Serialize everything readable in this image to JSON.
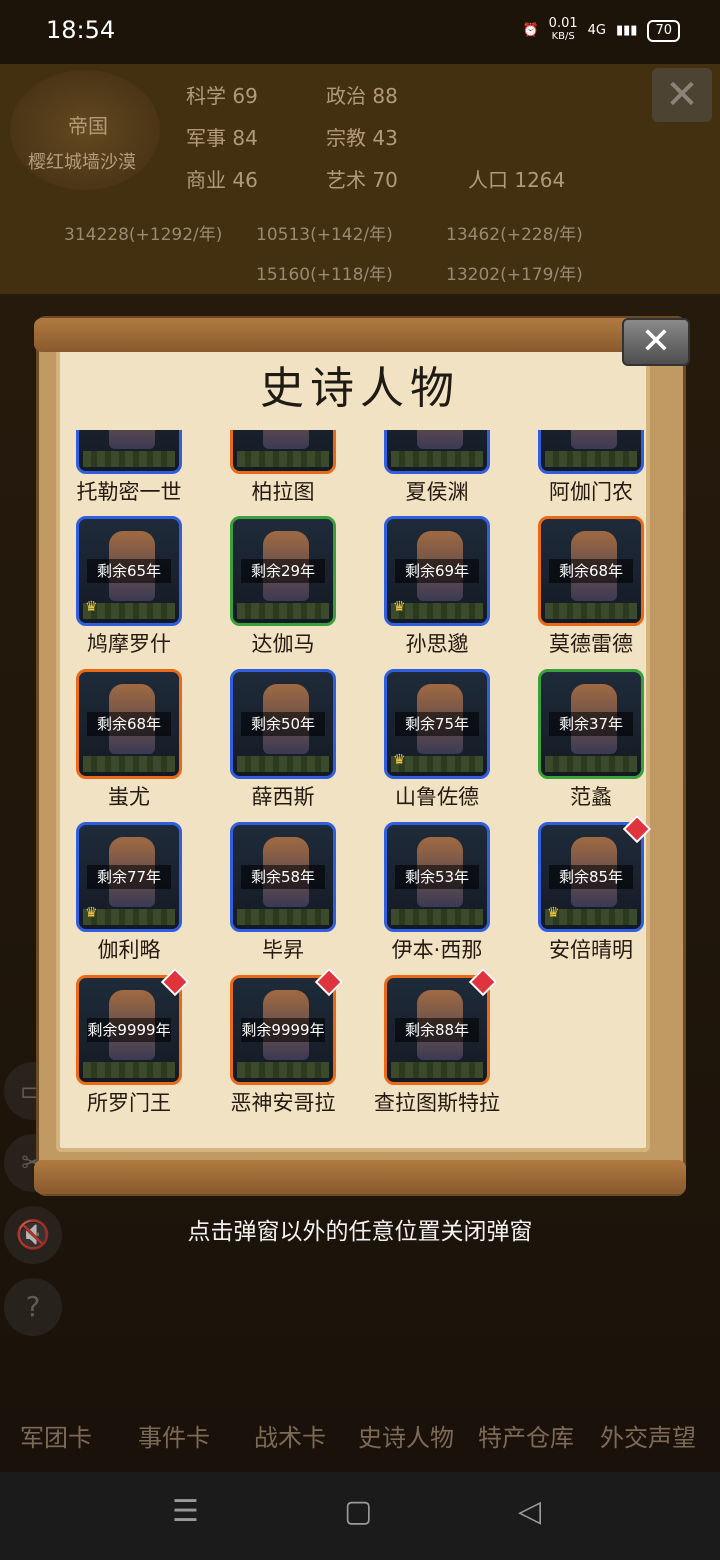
{
  "status_bar": {
    "time": "18:54",
    "net_speed": "0.01",
    "net_unit": "KB/S",
    "network": "4G",
    "battery": "70"
  },
  "background": {
    "emblem_title": "帝国",
    "emblem_subtitle": "樱红城墙沙漠",
    "stats": [
      {
        "label": "科学",
        "value": "69"
      },
      {
        "label": "政治",
        "value": "88"
      },
      {
        "label": "军事",
        "value": "84"
      },
      {
        "label": "宗教",
        "value": "43"
      },
      {
        "label": "商业",
        "value": "46"
      },
      {
        "label": "艺术",
        "value": "70"
      },
      {
        "label": "人口",
        "value": "1264"
      }
    ],
    "resources": [
      "314228(+1292/年)",
      "10513(+142/年)",
      "13462(+228/年)",
      "15160(+118/年)",
      "13202(+179/年)"
    ],
    "toolbar": [
      "军团卡",
      "事件卡",
      "战术卡",
      "史诗人物",
      "特产仓库",
      "外交声望"
    ]
  },
  "popup": {
    "title": "史诗人物",
    "close_icon": "close-icon",
    "hint": "点击弹窗以外的任意位置关闭弹窗",
    "characters": [
      {
        "name": "托勒密一世",
        "frame": "blue",
        "remaining": "",
        "crown": false,
        "new": false
      },
      {
        "name": "柏拉图",
        "frame": "orange",
        "remaining": "",
        "crown": false,
        "new": false
      },
      {
        "name": "夏侯渊",
        "frame": "blue",
        "remaining": "",
        "crown": false,
        "new": false
      },
      {
        "name": "阿伽门农",
        "frame": "blue",
        "remaining": "",
        "crown": false,
        "new": false
      },
      {
        "name": "鸠摩罗什",
        "frame": "blue",
        "remaining": "剩余65年",
        "crown": true,
        "new": false
      },
      {
        "name": "达伽马",
        "frame": "green",
        "remaining": "剩余29年",
        "crown": false,
        "new": false
      },
      {
        "name": "孙思邈",
        "frame": "blue",
        "remaining": "剩余69年",
        "crown": true,
        "new": false
      },
      {
        "name": "莫德雷德",
        "frame": "orange",
        "remaining": "剩余68年",
        "crown": false,
        "new": false
      },
      {
        "name": "蚩尤",
        "frame": "orange",
        "remaining": "剩余68年",
        "crown": false,
        "new": false
      },
      {
        "name": "薛西斯",
        "frame": "blue",
        "remaining": "剩余50年",
        "crown": false,
        "new": false
      },
      {
        "name": "山鲁佐德",
        "frame": "blue",
        "remaining": "剩余75年",
        "crown": true,
        "new": false
      },
      {
        "name": "范蠡",
        "frame": "green",
        "remaining": "剩余37年",
        "crown": false,
        "new": false
      },
      {
        "name": "伽利略",
        "frame": "blue",
        "remaining": "剩余77年",
        "crown": true,
        "new": false
      },
      {
        "name": "毕昇",
        "frame": "blue",
        "remaining": "剩余58年",
        "crown": false,
        "new": false
      },
      {
        "name": "伊本·西那",
        "frame": "blue",
        "remaining": "剩余53年",
        "crown": false,
        "new": false
      },
      {
        "name": "安倍晴明",
        "frame": "blue",
        "remaining": "剩余85年",
        "crown": true,
        "new": true
      },
      {
        "name": "所罗门王",
        "frame": "orange",
        "remaining": "剩余9999年",
        "crown": false,
        "new": true
      },
      {
        "name": "恶神安哥拉",
        "frame": "orange",
        "remaining": "剩余9999年",
        "crown": false,
        "new": true
      },
      {
        "name": "查拉图斯特拉",
        "frame": "orange",
        "remaining": "剩余88年",
        "crown": false,
        "new": true
      }
    ]
  },
  "navbar": {
    "menu_icon": "menu-icon",
    "home_icon": "home-icon",
    "back_icon": "back-icon"
  }
}
